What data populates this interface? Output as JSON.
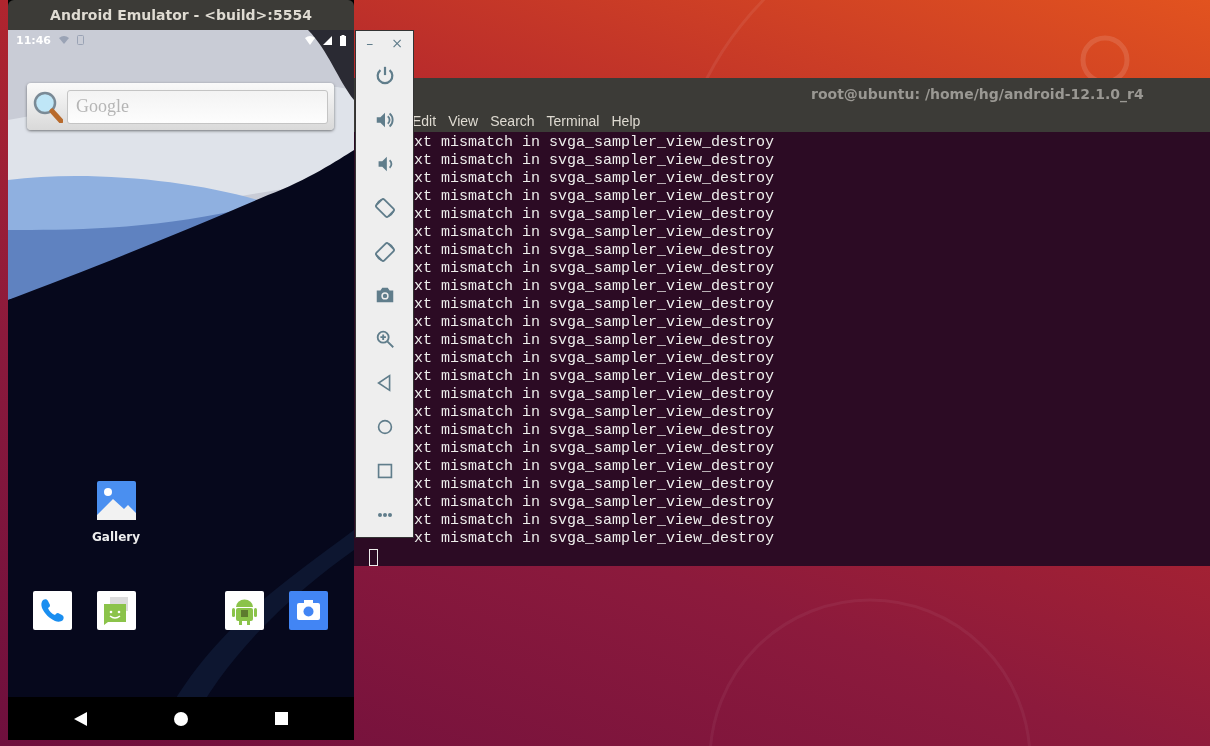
{
  "emulator": {
    "title": "Android Emulator - <build>:5554",
    "status_bar": {
      "time": "11:46"
    },
    "search_widget": {
      "placeholder": "Google"
    },
    "home_apps": [
      {
        "kind": "gallery",
        "label": "Gallery"
      }
    ],
    "dock": [
      {
        "kind": "phone"
      },
      {
        "kind": "messages"
      },
      {
        "kind": "android"
      },
      {
        "kind": "camera"
      }
    ],
    "nav": [
      {
        "kind": "back"
      },
      {
        "kind": "home"
      },
      {
        "kind": "recents"
      }
    ]
  },
  "emulator_controls": {
    "window_buttons": [
      "–",
      "×"
    ],
    "buttons": [
      {
        "kind": "power"
      },
      {
        "kind": "volume_up"
      },
      {
        "kind": "volume_down"
      },
      {
        "kind": "rotate_left"
      },
      {
        "kind": "rotate_right"
      },
      {
        "kind": "screenshot"
      },
      {
        "kind": "zoom"
      },
      {
        "kind": "back"
      },
      {
        "kind": "home"
      },
      {
        "kind": "overview"
      },
      {
        "kind": "more"
      }
    ]
  },
  "terminal": {
    "title": "root@ubuntu: /home/hg/android-12.1.0_r4",
    "menu": [
      "Edit",
      "View",
      "Search",
      "Terminal",
      "Help"
    ],
    "lines": [
      "xt mismatch in svga_sampler_view_destroy",
      "xt mismatch in svga_sampler_view_destroy",
      "xt mismatch in svga_sampler_view_destroy",
      "xt mismatch in svga_sampler_view_destroy",
      "xt mismatch in svga_sampler_view_destroy",
      "xt mismatch in svga_sampler_view_destroy",
      "xt mismatch in svga_sampler_view_destroy",
      "xt mismatch in svga_sampler_view_destroy",
      "xt mismatch in svga_sampler_view_destroy",
      "xt mismatch in svga_sampler_view_destroy",
      "xt mismatch in svga_sampler_view_destroy",
      "xt mismatch in svga_sampler_view_destroy",
      "xt mismatch in svga_sampler_view_destroy",
      "xt mismatch in svga_sampler_view_destroy",
      "xt mismatch in svga_sampler_view_destroy",
      "xt mismatch in svga_sampler_view_destroy",
      "xt mismatch in svga_sampler_view_destroy",
      "xt mismatch in svga_sampler_view_destroy",
      "xt mismatch in svga_sampler_view_destroy",
      "xt mismatch in svga_sampler_view_destroy",
      "xt mismatch in svga_sampler_view_destroy",
      "xt mismatch in svga_sampler_view_destroy"
    ],
    "last_line": "xt mismatch in svga_sampler_view_destroy"
  }
}
